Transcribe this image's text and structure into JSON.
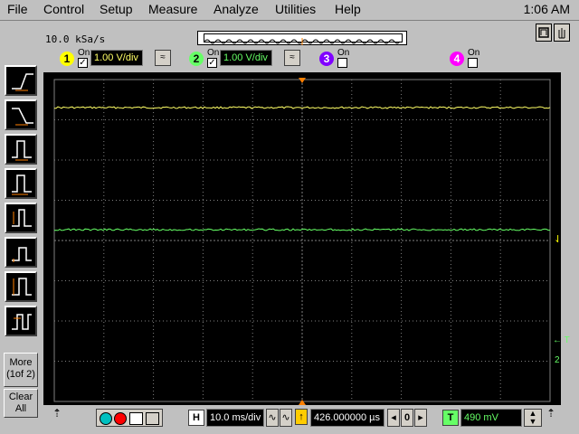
{
  "menu": {
    "items": [
      "File",
      "Control",
      "Setup",
      "Measure",
      "Analyze",
      "Utilities",
      "Help"
    ],
    "clock": "1:06 AM"
  },
  "acquisition": {
    "sample_rate": "10.0 kSa/s"
  },
  "channels": [
    {
      "number": "1",
      "on_label": "On",
      "checked": true,
      "scale": "1.00 V/div",
      "color": "#ffff66",
      "numbg": "#ffff00"
    },
    {
      "number": "2",
      "on_label": "On",
      "checked": true,
      "scale": "1.00 V/div",
      "color": "#66ff66",
      "numbg": "#66ff66"
    },
    {
      "number": "3",
      "on_label": "On",
      "checked": false,
      "color": "#8000ff"
    },
    {
      "number": "4",
      "on_label": "On",
      "checked": false,
      "color": "#ff00ff"
    }
  ],
  "left_panel": {
    "more_label": "More",
    "more_page": "(1of 2)",
    "clear_label": "Clear",
    "clear_all": "All"
  },
  "timebase": {
    "h_label": "H",
    "scale": "10.0 ms/div",
    "delay": "426.000000 µs",
    "trigger_label": "T",
    "trigger_level": "490 mV"
  },
  "screen_markers": {
    "trigger_marker": "← T",
    "ch2_marker": "2"
  },
  "colors": {
    "ch1": "#ffff66",
    "ch2": "#66ff66",
    "grid": "#808080",
    "accent_orange": "#ff8000"
  }
}
